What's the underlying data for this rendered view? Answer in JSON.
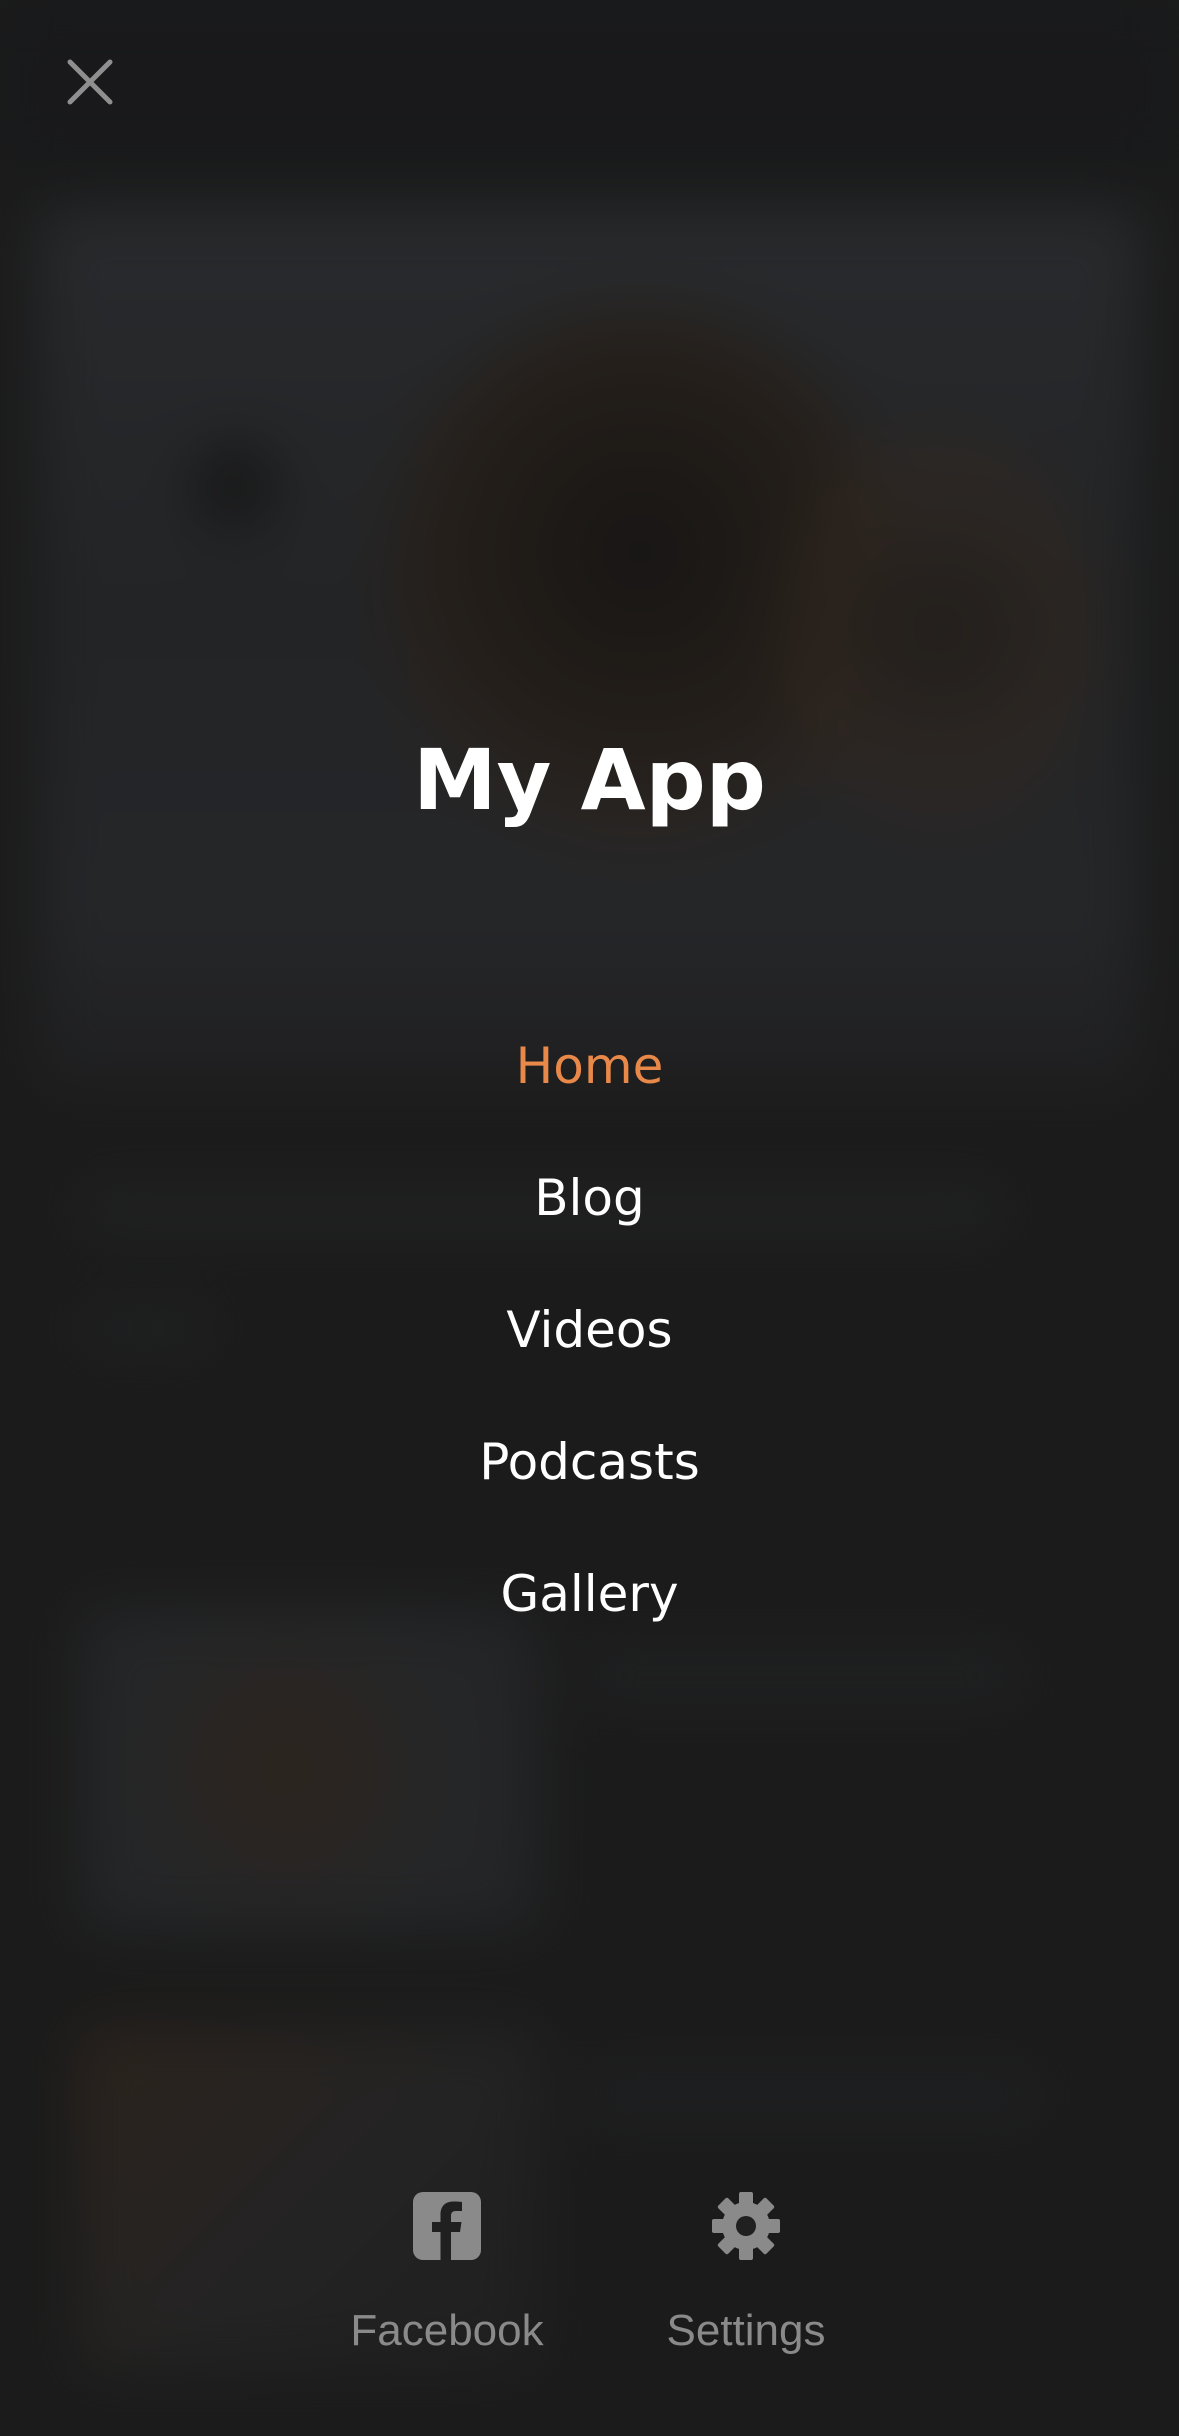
{
  "header": {
    "close_icon": "close-icon"
  },
  "app": {
    "title": "My App"
  },
  "menu": {
    "items": [
      {
        "label": "Home",
        "active": true
      },
      {
        "label": "Blog",
        "active": false
      },
      {
        "label": "Videos",
        "active": false
      },
      {
        "label": "Podcasts",
        "active": false
      },
      {
        "label": "Gallery",
        "active": false
      }
    ]
  },
  "bottom_bar": {
    "facebook": {
      "label": "Facebook",
      "icon": "facebook-icon"
    },
    "settings": {
      "label": "Settings",
      "icon": "gear-icon"
    }
  },
  "colors": {
    "background": "#202020",
    "accent": "#e8894a",
    "menu_text": "#ffffff",
    "muted": "#8a8a8a"
  }
}
